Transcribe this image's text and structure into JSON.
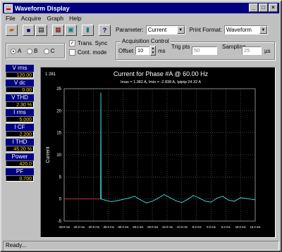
{
  "window": {
    "title": "Waveform Display"
  },
  "menu": [
    "File",
    "Acquire",
    "Graph",
    "Help"
  ],
  "toolbar": {
    "tools": [
      "open-icon",
      "save-icon",
      "print-icon",
      "copy-icon",
      "acquire-icon",
      "exit-icon",
      "help-icon"
    ],
    "parameter_label": "Parameter:",
    "parameter_value": "Current",
    "print_format_label": "Print Format:",
    "print_format_value": "Waveform"
  },
  "phase": {
    "options": [
      "A",
      "B",
      "C"
    ],
    "selected": "A"
  },
  "trans_sync": {
    "label": "Trans. Sync",
    "checked": true
  },
  "cont_mode": {
    "label": "Cont. mode",
    "checked": false
  },
  "acquisition": {
    "title": "Acquisition Control",
    "offset_label": "Offset",
    "offset_value": "10",
    "offset_unit": "ms",
    "trig_label": "Trig pts",
    "trig_value": "50",
    "sampling_label": "Sampling",
    "sampling_value": "25",
    "sampling_unit": "µs"
  },
  "measurements": [
    {
      "label": "V rms",
      "value": "120.00"
    },
    {
      "label": "V dc",
      "value": "0.00"
    },
    {
      "label": "V THD",
      "value": "2.30 %"
    },
    {
      "label": "I rms",
      "value": "5.000"
    },
    {
      "label": "I CF",
      "value": "2.200"
    },
    {
      "label": "I THD",
      "value": "45.20 %"
    },
    {
      "label": "Power",
      "value": "420.0"
    },
    {
      "label": "PF",
      "value": "0.700"
    }
  ],
  "plot": {
    "corner_label": "1 281",
    "title": "Current for Phase #A @ 60.00 Hz",
    "subtitle": "Imax = 1.382 A, Imin = -2.838 A, Iptptp 24.32 A",
    "ylabel": "Current",
    "colors": {
      "background": "#000000",
      "grid": "#8a8a8a",
      "trace": "#40c8c8",
      "baseline": "#c83232"
    }
  },
  "chart_data": {
    "type": "line",
    "title": "Current for Phase #A @ 60.00 Hz",
    "ylabel": "Current",
    "ylim": [
      -5,
      25
    ],
    "yticks": [
      25,
      20,
      15,
      10,
      5,
      0,
      -5
    ],
    "xticks": [
      "-50.0 ms",
      "-45.0 ms",
      "-40.0 ms",
      "-35.0 ms",
      "-30.0 ms",
      "-25.0 ms",
      "-20.0 ms",
      "-15.0 ms",
      "-10.0 ms",
      "-5.0 ms",
      "0.0 ms",
      "5.0 ms",
      "10.0 ms",
      "15.0 ms"
    ],
    "series": [
      {
        "x": [
          -50,
          -45,
          -40,
          -38,
          -37.6,
          -37.5,
          -37.4,
          -36,
          -34,
          -32,
          -30,
          -28,
          -26,
          -24,
          -22,
          -20,
          -18,
          -16,
          -14,
          -12,
          -10,
          -8,
          -6,
          -4,
          -2,
          0,
          2,
          4,
          6,
          8,
          10,
          12,
          15
        ],
        "y": [
          0,
          0,
          0,
          0,
          0,
          24,
          0,
          -0.3,
          -0.6,
          -0.4,
          -0.1,
          0.2,
          0.6,
          -0.2,
          -0.9,
          -0.5,
          0.2,
          1.0,
          0.3,
          -0.4,
          -0.8,
          -0.1,
          0.8,
          0.2,
          -0.5,
          -0.7,
          0.2,
          0.6,
          -0.3,
          -0.5,
          0.3,
          0.1,
          -0.2
        ]
      }
    ]
  },
  "status": {
    "text": "Ready..."
  }
}
